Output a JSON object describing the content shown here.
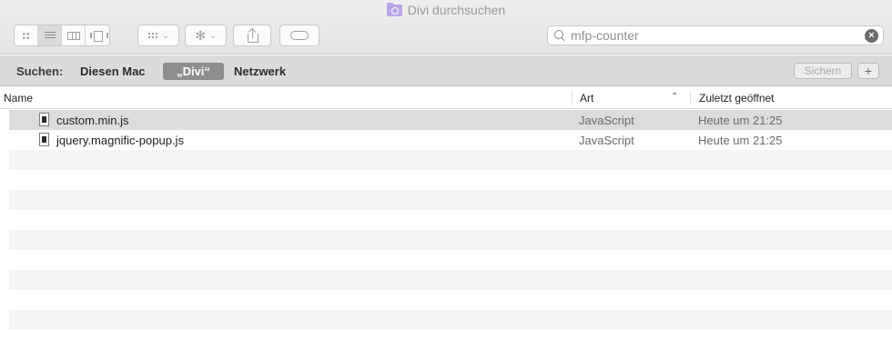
{
  "window": {
    "title": "Divi durchsuchen",
    "title_icon": "folder-icon"
  },
  "toolbar": {
    "view_modes": [
      "icon-view",
      "list-view",
      "column-view",
      "cover-flow-view"
    ],
    "active_view": "list-view",
    "arrange_icon": "arrange-icon",
    "action_icon": "gear-icon",
    "share_icon": "share-icon",
    "tag_icon": "tag-icon"
  },
  "search": {
    "value": "mfp-counter",
    "placeholder": "Suche"
  },
  "scope_bar": {
    "label": "Suchen:",
    "items": [
      "Diesen Mac",
      "„Divi“",
      "Netzwerk"
    ],
    "active": "„Divi“",
    "save_label": "Sichern",
    "add_label": "+"
  },
  "columns": {
    "name": "Name",
    "kind": "Art",
    "date": "Zuletzt geöffnet",
    "sort_indicator": "^"
  },
  "files": [
    {
      "name": "custom.min.js",
      "kind": "JavaScript",
      "date": "Heute um 21:25",
      "selected": true
    },
    {
      "name": "jquery.magnific-popup.js",
      "kind": "JavaScript",
      "date": "Heute um 21:25",
      "selected": false
    }
  ]
}
